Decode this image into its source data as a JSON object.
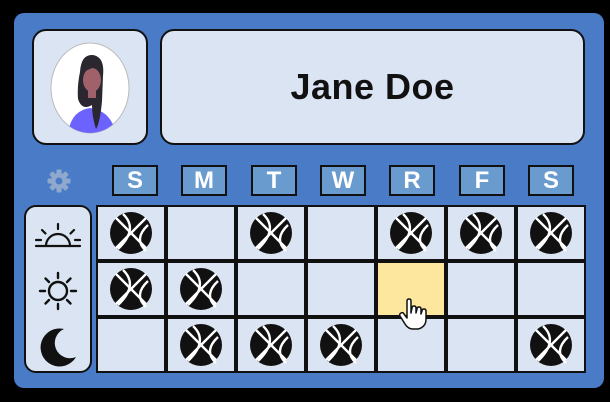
{
  "profile": {
    "name": "Jane Doe",
    "avatar_icon": "woman-avatar-icon"
  },
  "settings": {
    "icon": "gear-icon"
  },
  "days": [
    "S",
    "M",
    "T",
    "W",
    "R",
    "F",
    "S"
  ],
  "periods": [
    {
      "name": "morning",
      "icon": "sunrise-icon"
    },
    {
      "name": "midday",
      "icon": "sun-icon"
    },
    {
      "name": "night",
      "icon": "moon-icon"
    }
  ],
  "schedule": [
    [
      true,
      false,
      true,
      false,
      true,
      true,
      true
    ],
    [
      true,
      true,
      false,
      false,
      false,
      false,
      false
    ],
    [
      false,
      true,
      true,
      true,
      false,
      false,
      true
    ]
  ],
  "activity_icon": "basketball-icon",
  "hovered_cell": {
    "row": 1,
    "col": 4
  },
  "colors": {
    "frame": "#4a7bc7",
    "cell": "#dbe4f2",
    "day_header": "#6a9bcf",
    "hover": "#fde69e"
  }
}
